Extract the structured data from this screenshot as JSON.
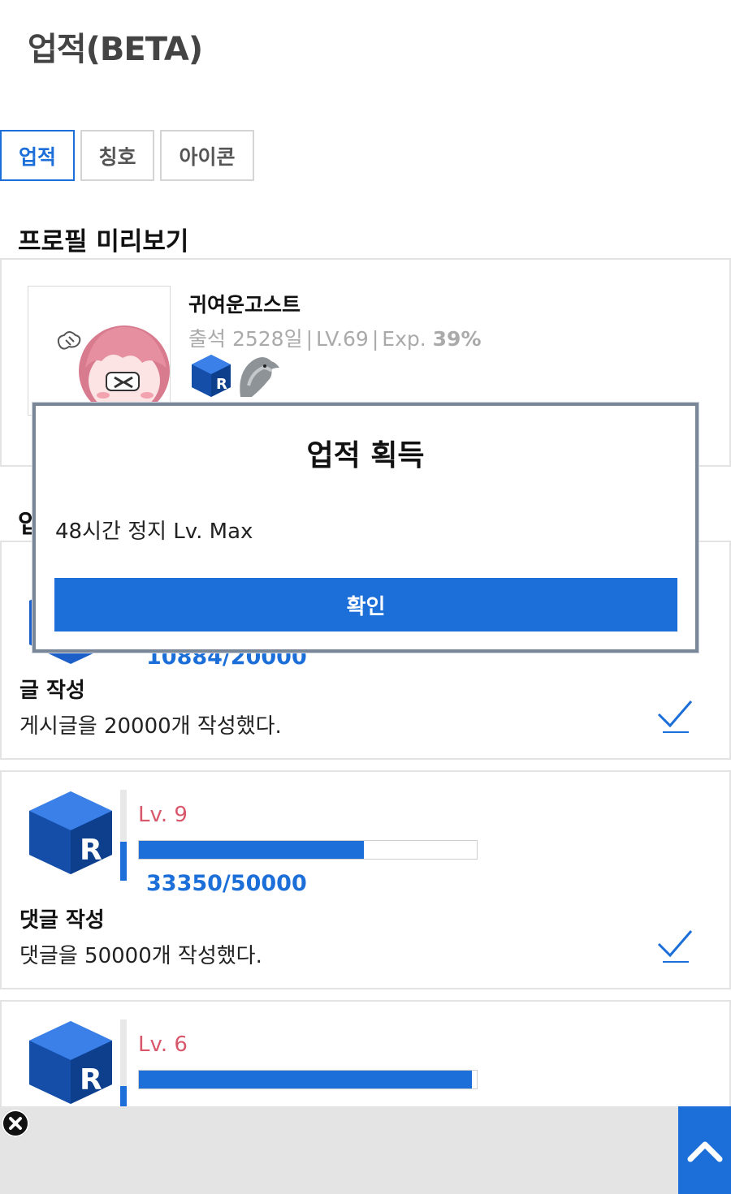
{
  "header": {
    "title": "업적(BETA)"
  },
  "tabs": [
    {
      "label": "업적",
      "active": true
    },
    {
      "label": "칭호",
      "active": false
    },
    {
      "label": "아이콘",
      "active": false
    }
  ],
  "profile": {
    "section_title": "프로필 미리보기",
    "name": "귀여운고스트",
    "attendance": "출석 2528일",
    "level": "LV.69",
    "exp_label": "Exp.",
    "exp_value": "39%",
    "badges": [
      "rank-cube-badge",
      "dolphin-badge"
    ]
  },
  "achievements": {
    "section_title_partial": "업",
    "items": [
      {
        "progress_text": "10884/20000",
        "progress_fraction": 0.5442,
        "name": "글 작성",
        "description": "게시글을 20000개 작성했다."
      },
      {
        "level": "Lv. 9",
        "progress_text": "33350/50000",
        "progress_fraction": 0.667,
        "name": "댓글 작성",
        "description": "댓글을 50000개 작성했다."
      },
      {
        "level": "Lv. 6",
        "progress_fraction": 0.985
      }
    ]
  },
  "modal": {
    "title": "업적 획득",
    "message": "48시간 정지 Lv. Max",
    "confirm_label": "확인"
  },
  "colors": {
    "accent": "#1c6fd8",
    "level_text": "#d9576a",
    "modal_border": "#7a8799",
    "ad_background": "#e4e4e4"
  }
}
